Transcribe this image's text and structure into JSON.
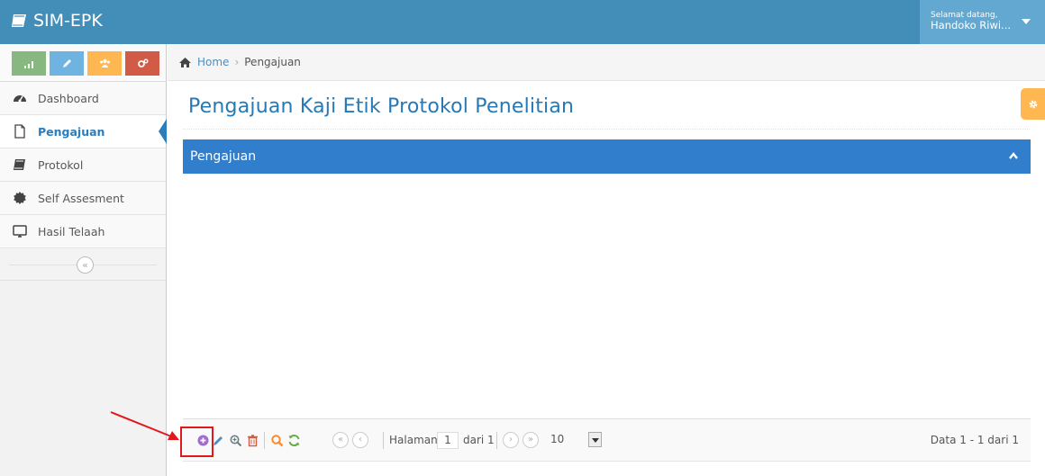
{
  "navbar": {
    "brand": "SIM-EPK",
    "greeting": "Selamat datang,",
    "user_name": "Handoko Riwi..."
  },
  "shortcuts": [
    {
      "name": "shortcut-stats",
      "color": "#87b87f",
      "icon": "signal-icon"
    },
    {
      "name": "shortcut-edit",
      "color": "#6fb3e0",
      "icon": "pencil-icon"
    },
    {
      "name": "shortcut-users",
      "color": "#ffb752",
      "icon": "group-icon"
    },
    {
      "name": "shortcut-settings",
      "color": "#d15b47",
      "icon": "cogs-icon"
    }
  ],
  "sidebar": {
    "items": [
      {
        "label": "Dashboard",
        "icon": "dashboard-icon"
      },
      {
        "label": "Pengajuan",
        "icon": "file-icon",
        "active": true
      },
      {
        "label": "Protokol",
        "icon": "book-icon"
      },
      {
        "label": "Self Assesment",
        "icon": "certificate-icon"
      },
      {
        "label": "Hasil Telaah",
        "icon": "desktop-icon"
      }
    ],
    "collapse": "«"
  },
  "breadcrumb": {
    "home": "Home",
    "separator": "›",
    "current": "Pengajuan"
  },
  "page": {
    "title": "Pengajuan Kaji Etik Protokol Penelitian"
  },
  "panel": {
    "title": "Pengajuan"
  },
  "pager": {
    "first": "«",
    "prev": "‹",
    "next": "›",
    "last": "»",
    "page_label": "Halaman",
    "page_value": "1",
    "of_label": "dari 1",
    "page_size": "10",
    "records": "Data 1 - 1 dari 1"
  },
  "colors": {
    "navbar": "#438eb9",
    "panel_header": "#307ecc",
    "add_icon": "#9f6ec9",
    "edit_icon": "#4c8fbd",
    "delete_icon": "#d15b47",
    "search_icon": "#ff892a",
    "refresh_icon": "#69aa46",
    "highlight": "#e2191b"
  }
}
